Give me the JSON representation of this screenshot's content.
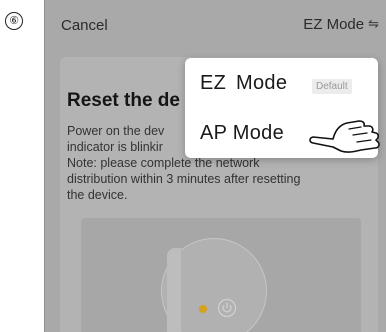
{
  "step_marker": "⑥",
  "header": {
    "cancel_label": "Cancel",
    "mode_label": "EZ Mode",
    "mode_icon": "⇋"
  },
  "card": {
    "title": "Reset the de",
    "desc_lines": [
      "Power on the dev",
      "indicator is blinkir",
      "Note: please complete the network",
      "distribution within 3 minutes after resetting",
      "the device."
    ]
  },
  "menu": {
    "items": [
      {
        "label": "EZ Mode",
        "badge": "Default"
      },
      {
        "label": "AP Mode"
      }
    ]
  },
  "icons": [
    "swap-icon",
    "power-icon",
    "pointing-hand-icon",
    "indicator-led"
  ],
  "colors": {
    "overlay": "#a9a9a9",
    "menu_bg": "#ffffff",
    "indicator_led": "#d4a21c"
  }
}
